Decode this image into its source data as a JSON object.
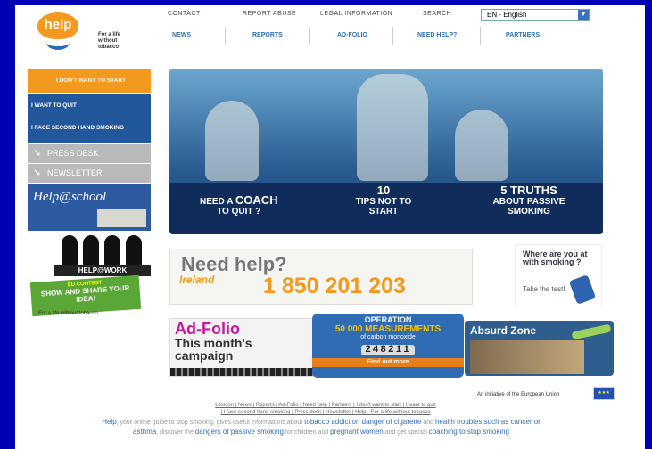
{
  "header": {
    "logo_text": "help",
    "tagline": "For a life without tobacco",
    "top_links": [
      "CONTACT",
      "REPORT ABUSE",
      "LEGAL INFORMATION",
      "SEARCH"
    ],
    "language": "EN - English",
    "nav": [
      "NEWS",
      "REPORTS",
      "AD-FOLIO",
      "NEED HELP?",
      "PARTNERS"
    ]
  },
  "sidebar": {
    "items": [
      "I DON'T WANT TO START",
      "I WANT TO QUIT",
      "I FACE SECOND HAND SMOKING",
      "PRESS DESK",
      "NEWSLETTER"
    ],
    "school_banner": "Help@school",
    "work_banner": "HELP@WORK",
    "contest_top": "EU CONTEST",
    "contest_main": "SHOW AND SHARE YOUR IDEA!",
    "footer_tagline": "For a life without tobacco"
  },
  "hero": {
    "captions": [
      {
        "small": "NEED A",
        "big": "COACH",
        "rest": "TO QUIT ?"
      },
      {
        "small": "",
        "big": "10",
        "rest": "TIPS NOT TO START"
      },
      {
        "small": "",
        "big": "5 TRUTHS",
        "rest": "ABOUT PASSIVE SMOKING"
      }
    ]
  },
  "helpline": {
    "title": "Need help?",
    "country": "Ireland",
    "number": "1 850 201 203"
  },
  "test": {
    "question": "Where are you at with smoking ?",
    "cta": "Take the test!"
  },
  "adfolio": {
    "title": "Ad-Folio",
    "subtitle": "This month's campaign"
  },
  "operation": {
    "title": "OPERATION",
    "measurements": "50 000 MEASUREMENTS",
    "of": "of carbon monoxide",
    "counter": "248211",
    "cta": "Find out more"
  },
  "absurd": {
    "title": "Absurd Zone"
  },
  "footer": {
    "initiative": "An initiative of the European Union",
    "links_line1": "Lexicon | News | Reports | Ad-Folio | Need help | Partners | I don't want to start | I want to quit",
    "links_line2": "| I face second hand smoking | Press desk | Newsletter | Help - For a life without tobacco",
    "desc_help": "Help",
    "desc_1": ", your online guide to stop smoking, gives useful informations about",
    "desc_kw1": "tobacco addiction danger of cigarette",
    "desc_2": "and",
    "desc_kw2": "health troubles such as cancer or asthma",
    "desc_3": ", discover the",
    "desc_kw3": "dangers of passive smoking",
    "desc_4": "for children and",
    "desc_kw4": "pregnant women",
    "desc_5": "and get special",
    "desc_kw5": "coaching to stop smoking"
  },
  "colors": {
    "background": "#0000b4",
    "orange": "#f39a1e",
    "nav_blue": "#23579b",
    "link_blue": "#2f6fb6"
  }
}
